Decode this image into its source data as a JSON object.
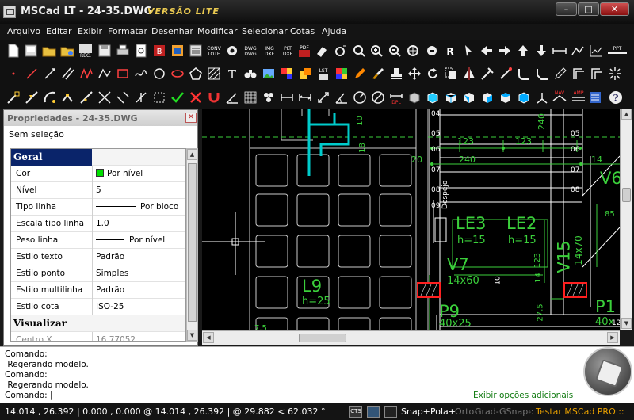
{
  "window": {
    "app_name": "MSCad LT - 24-35.DWG",
    "edition": "Versão Lite",
    "min": "–",
    "max": "□",
    "close": "✕"
  },
  "menu": [
    "Arquivo",
    "Editar",
    "Exibir",
    "Formatar",
    "Desenhar",
    "Modificar",
    "Selecionar",
    "Cotas",
    "Ajuda"
  ],
  "toolbar_labels": {
    "rec": "REC.",
    "conv_lote": "CONV\nLOTE",
    "dwg_dwg": "DWG\nDWG",
    "img_dxf": "IMG\nDXF",
    "plt_dxf": "PLT\nDXF",
    "pdf": "PDF",
    "r": "R",
    "b": "B",
    "dpl": "DPL",
    "nav": "NAV",
    "amp": "AMP",
    "lst": "LST",
    "cnt": "CNT",
    "t": "T",
    "ppt": "PPT"
  },
  "properties": {
    "title": "Propriedades - 24-35.DWG",
    "close": "✕",
    "selection": "Sem seleção",
    "category_general": "Geral",
    "rows": [
      {
        "label": "Cor",
        "value": "Por nível"
      },
      {
        "label": "Nível",
        "value": "5"
      },
      {
        "label": "Tipo linha",
        "value": "Por bloco"
      },
      {
        "label": "Escala tipo linha",
        "value": "1.0"
      },
      {
        "label": "Peso linha",
        "value": "Por nível"
      },
      {
        "label": "Estilo texto",
        "value": "Padrão"
      },
      {
        "label": "Estilo ponto",
        "value": "Simples"
      },
      {
        "label": "Estilo multilinha",
        "value": "Padrão"
      },
      {
        "label": "Estilo cota",
        "value": "ISO-25"
      }
    ],
    "category_view": "Visualizar",
    "partial_row": {
      "label": "Centro X",
      "value": "16.77052"
    },
    "swatch_color": "#00e000"
  },
  "drawing": {
    "labels": {
      "d04": "04",
      "d05": "05",
      "d06": "06",
      "d07": "07",
      "d08": "08",
      "d09": "09",
      "dim123a": "123",
      "dim123b": "123",
      "dim240": "240",
      "dim240v": "240",
      "dim20": "20",
      "dim14a": "14",
      "dim14b": "14",
      "dim10v": "10",
      "dim18v": "18",
      "dim8": "8",
      "dim85": "85",
      "le3": "LE3",
      "le3h": "h=15",
      "le2": "LE2",
      "le2h": "h=15",
      "v15": "V15",
      "v15s": "14x70",
      "v7": "V7",
      "v7s": "14x60",
      "l9": "L9",
      "l9h": "h=25",
      "p9": "P9",
      "p9s": "40x25",
      "p1": "P1",
      "p1s": "40x",
      "v6": "V6",
      "dim14v": "14",
      "dim123v": "123",
      "dim275v": "27.5",
      "dim10b": "10",
      "dim75": "7.5",
      "dim12": "12",
      "despejo": "Despejo"
    },
    "colors": {
      "cad_green": "#3bd03b",
      "cad_white": "#ffffff",
      "cad_cyan": "#00cccc",
      "cad_red": "#ff2020"
    }
  },
  "command": {
    "history": [
      "Comando:",
      " Regerando modelo.",
      "Comando:",
      " Regerando modelo."
    ],
    "prompt": "Comando: |",
    "more_options": "Exibir opções adicionais"
  },
  "status": {
    "coords": "14.014 , 26.392 | 0.000 , 0.000 @ 14.014 , 26.392 | @ 29.882 < 62.032 °",
    "cts": "CTS",
    "modes": [
      {
        "label": "Snap+",
        "on": true
      },
      {
        "label": "Pola+",
        "on": true
      },
      {
        "label": "Orto-",
        "on": false
      },
      {
        "label": "Grad-",
        "on": false
      },
      {
        "label": "GSnap-",
        "on": false
      },
      {
        "label": "::",
        "on": false
      }
    ],
    "testar": "Testar MSCad PRO ::"
  }
}
